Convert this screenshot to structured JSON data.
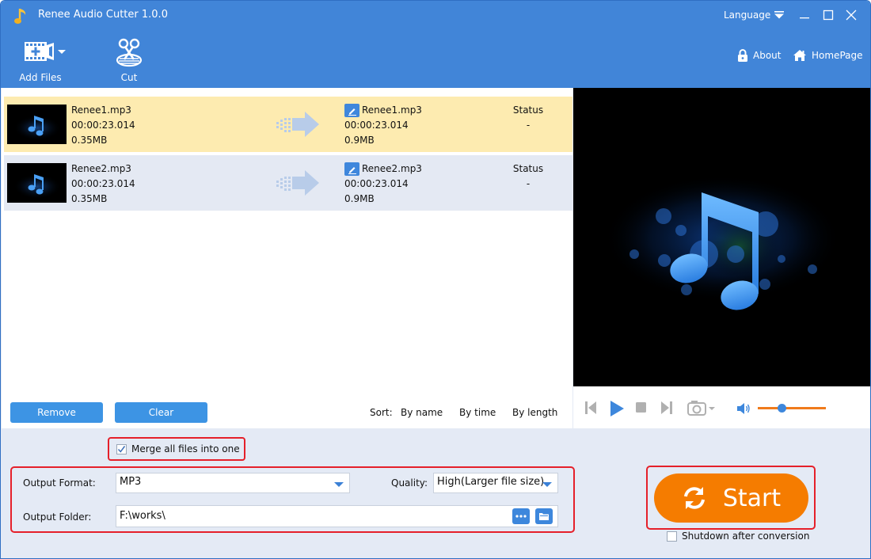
{
  "window": {
    "title": "Renee Audio Cutter 1.0.0",
    "language_label": "Language"
  },
  "toolbar": {
    "add_files_label": "Add Files",
    "cut_label": "Cut",
    "about_label": "About",
    "homepage_label": "HomePage"
  },
  "files": [
    {
      "source_name": "Renee1.mp3",
      "source_duration": "00:00:23.014",
      "source_size": "0.35MB",
      "output_name": "Renee1.mp3",
      "output_duration": "00:00:23.014",
      "output_size": "0.9MB",
      "status_label": "Status",
      "status_value": "-",
      "selected": true
    },
    {
      "source_name": "Renee2.mp3",
      "source_duration": "00:00:23.014",
      "source_size": "0.35MB",
      "output_name": "Renee2.mp3",
      "output_duration": "00:00:23.014",
      "output_size": "0.9MB",
      "status_label": "Status",
      "status_value": "-",
      "selected": false
    }
  ],
  "list_actions": {
    "remove_label": "Remove",
    "clear_label": "Clear",
    "sort_label": "Sort:",
    "sort_by_name": "By name",
    "sort_by_time": "By time",
    "sort_by_length": "By length"
  },
  "player": {
    "volume_fraction": 0.35
  },
  "options": {
    "merge_label": "Merge all files into one",
    "merge_checked": true,
    "output_format_label": "Output Format:",
    "output_format_value": "MP3",
    "quality_label": "Quality:",
    "quality_value": "High(Larger file size)",
    "output_folder_label": "Output Folder:",
    "output_folder_value": "F:\\works\\",
    "shutdown_label": "Shutdown after conversion",
    "shutdown_checked": false
  },
  "start": {
    "label": "Start"
  },
  "colors": {
    "header_blue": "#4185d8",
    "accent_orange": "#f57c00",
    "highlight_red": "#e5202a",
    "selected_row": "#fdebb0"
  }
}
